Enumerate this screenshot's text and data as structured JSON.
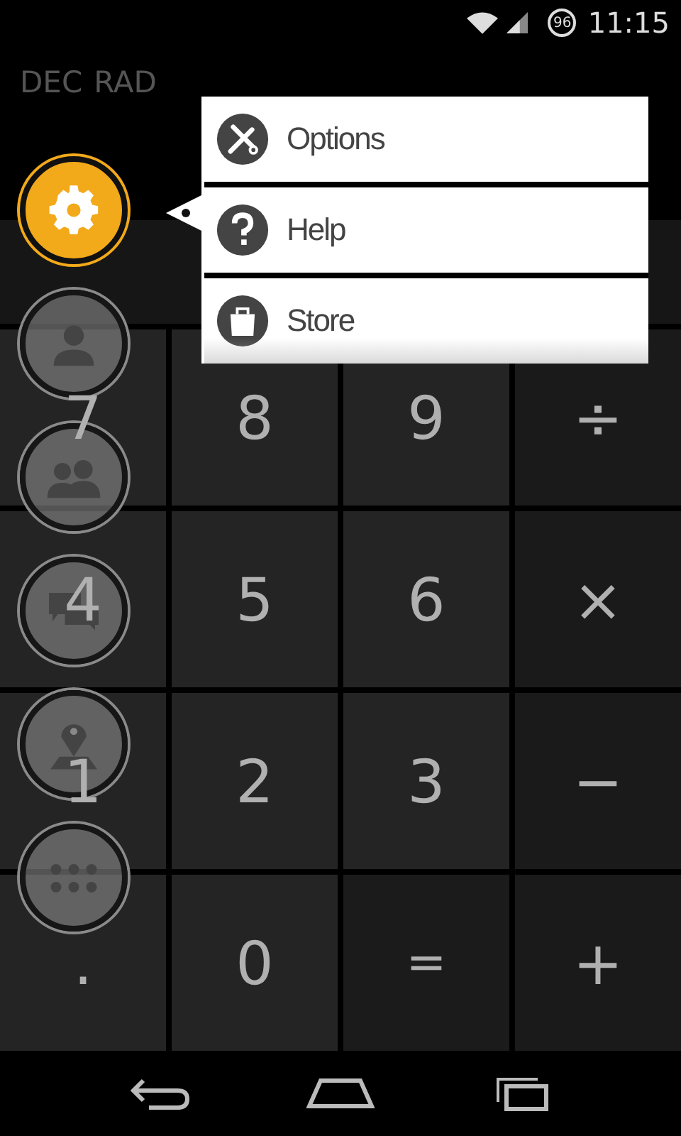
{
  "status_bar": {
    "battery": "96",
    "time": "11:15"
  },
  "display": {
    "modes": [
      "DEC",
      "RAD"
    ]
  },
  "side_buttons": [
    {
      "kind": "settings",
      "selected": true
    },
    {
      "kind": "person",
      "selected": false
    },
    {
      "kind": "group",
      "selected": false
    },
    {
      "kind": "chat",
      "selected": false
    },
    {
      "kind": "location",
      "selected": false
    },
    {
      "kind": "apps",
      "selected": false
    }
  ],
  "menu": {
    "items": [
      {
        "kind": "tools",
        "label": "Options"
      },
      {
        "kind": "help",
        "label": "Help"
      },
      {
        "kind": "store",
        "label": "Store"
      }
    ]
  },
  "keypad": {
    "keys": [
      {
        "kind": "digit",
        "label": "7"
      },
      {
        "kind": "digit",
        "label": "8"
      },
      {
        "kind": "digit",
        "label": "9"
      },
      {
        "kind": "operator",
        "label": "÷"
      },
      {
        "kind": "digit",
        "label": "4"
      },
      {
        "kind": "digit",
        "label": "5"
      },
      {
        "kind": "digit",
        "label": "6"
      },
      {
        "kind": "operator",
        "label": "×"
      },
      {
        "kind": "digit",
        "label": "1"
      },
      {
        "kind": "digit",
        "label": "2"
      },
      {
        "kind": "digit",
        "label": "3"
      },
      {
        "kind": "operator",
        "label": "−"
      },
      {
        "kind": "digit",
        "label": "."
      },
      {
        "kind": "digit",
        "label": "0"
      },
      {
        "kind": "equals",
        "label": "="
      },
      {
        "kind": "operator",
        "label": "+"
      }
    ]
  }
}
